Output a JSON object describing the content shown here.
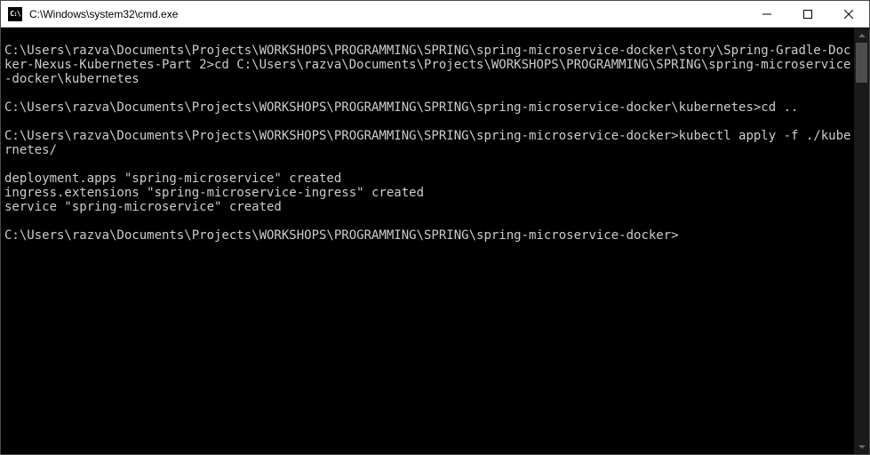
{
  "titlebar": {
    "icon_label": "C:\\",
    "title": "C:\\Windows\\system32\\cmd.exe"
  },
  "terminal": {
    "lines": [
      "",
      "C:\\Users\\razva\\Documents\\Projects\\WORKSHOPS\\PROGRAMMING\\SPRING\\spring-microservice-docker\\story\\Spring-Gradle-Docker-Nexus-Kubernetes-Part 2>cd C:\\Users\\razva\\Documents\\Projects\\WORKSHOPS\\PROGRAMMING\\SPRING\\spring-microservice-docker\\kubernetes",
      "",
      "C:\\Users\\razva\\Documents\\Projects\\WORKSHOPS\\PROGRAMMING\\SPRING\\spring-microservice-docker\\kubernetes>cd ..",
      "",
      "C:\\Users\\razva\\Documents\\Projects\\WORKSHOPS\\PROGRAMMING\\SPRING\\spring-microservice-docker>kubectl apply -f ./kubernetes/",
      "",
      "deployment.apps \"spring-microservice\" created",
      "ingress.extensions \"spring-microservice-ingress\" created",
      "service \"spring-microservice\" created",
      "",
      "C:\\Users\\razva\\Documents\\Projects\\WORKSHOPS\\PROGRAMMING\\SPRING\\spring-microservice-docker>"
    ]
  }
}
